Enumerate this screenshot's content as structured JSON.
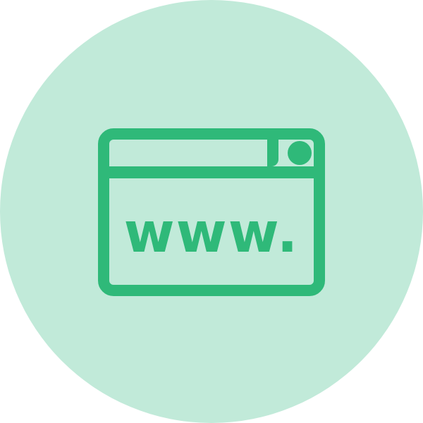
{
  "icon": {
    "name": "website-icon",
    "url_text": "www."
  },
  "colors": {
    "circle_background": "#c1ead9",
    "icon_green": "#2fb979"
  }
}
